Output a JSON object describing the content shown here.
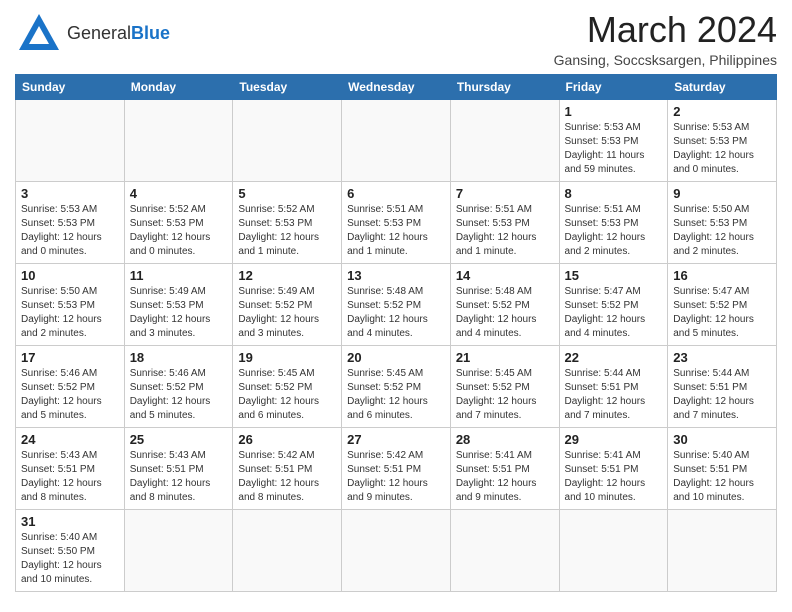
{
  "header": {
    "logo_general": "General",
    "logo_blue": "Blue",
    "title": "March 2024",
    "subtitle": "Gansing, Soccsksargen, Philippines"
  },
  "weekdays": [
    "Sunday",
    "Monday",
    "Tuesday",
    "Wednesday",
    "Thursday",
    "Friday",
    "Saturday"
  ],
  "weeks": [
    [
      {
        "day": "",
        "info": ""
      },
      {
        "day": "",
        "info": ""
      },
      {
        "day": "",
        "info": ""
      },
      {
        "day": "",
        "info": ""
      },
      {
        "day": "",
        "info": ""
      },
      {
        "day": "1",
        "info": "Sunrise: 5:53 AM\nSunset: 5:53 PM\nDaylight: 11 hours and 59 minutes."
      },
      {
        "day": "2",
        "info": "Sunrise: 5:53 AM\nSunset: 5:53 PM\nDaylight: 12 hours and 0 minutes."
      }
    ],
    [
      {
        "day": "3",
        "info": "Sunrise: 5:53 AM\nSunset: 5:53 PM\nDaylight: 12 hours and 0 minutes."
      },
      {
        "day": "4",
        "info": "Sunrise: 5:52 AM\nSunset: 5:53 PM\nDaylight: 12 hours and 0 minutes."
      },
      {
        "day": "5",
        "info": "Sunrise: 5:52 AM\nSunset: 5:53 PM\nDaylight: 12 hours and 1 minute."
      },
      {
        "day": "6",
        "info": "Sunrise: 5:51 AM\nSunset: 5:53 PM\nDaylight: 12 hours and 1 minute."
      },
      {
        "day": "7",
        "info": "Sunrise: 5:51 AM\nSunset: 5:53 PM\nDaylight: 12 hours and 1 minute."
      },
      {
        "day": "8",
        "info": "Sunrise: 5:51 AM\nSunset: 5:53 PM\nDaylight: 12 hours and 2 minutes."
      },
      {
        "day": "9",
        "info": "Sunrise: 5:50 AM\nSunset: 5:53 PM\nDaylight: 12 hours and 2 minutes."
      }
    ],
    [
      {
        "day": "10",
        "info": "Sunrise: 5:50 AM\nSunset: 5:53 PM\nDaylight: 12 hours and 2 minutes."
      },
      {
        "day": "11",
        "info": "Sunrise: 5:49 AM\nSunset: 5:53 PM\nDaylight: 12 hours and 3 minutes."
      },
      {
        "day": "12",
        "info": "Sunrise: 5:49 AM\nSunset: 5:52 PM\nDaylight: 12 hours and 3 minutes."
      },
      {
        "day": "13",
        "info": "Sunrise: 5:48 AM\nSunset: 5:52 PM\nDaylight: 12 hours and 4 minutes."
      },
      {
        "day": "14",
        "info": "Sunrise: 5:48 AM\nSunset: 5:52 PM\nDaylight: 12 hours and 4 minutes."
      },
      {
        "day": "15",
        "info": "Sunrise: 5:47 AM\nSunset: 5:52 PM\nDaylight: 12 hours and 4 minutes."
      },
      {
        "day": "16",
        "info": "Sunrise: 5:47 AM\nSunset: 5:52 PM\nDaylight: 12 hours and 5 minutes."
      }
    ],
    [
      {
        "day": "17",
        "info": "Sunrise: 5:46 AM\nSunset: 5:52 PM\nDaylight: 12 hours and 5 minutes."
      },
      {
        "day": "18",
        "info": "Sunrise: 5:46 AM\nSunset: 5:52 PM\nDaylight: 12 hours and 5 minutes."
      },
      {
        "day": "19",
        "info": "Sunrise: 5:45 AM\nSunset: 5:52 PM\nDaylight: 12 hours and 6 minutes."
      },
      {
        "day": "20",
        "info": "Sunrise: 5:45 AM\nSunset: 5:52 PM\nDaylight: 12 hours and 6 minutes."
      },
      {
        "day": "21",
        "info": "Sunrise: 5:45 AM\nSunset: 5:52 PM\nDaylight: 12 hours and 7 minutes."
      },
      {
        "day": "22",
        "info": "Sunrise: 5:44 AM\nSunset: 5:51 PM\nDaylight: 12 hours and 7 minutes."
      },
      {
        "day": "23",
        "info": "Sunrise: 5:44 AM\nSunset: 5:51 PM\nDaylight: 12 hours and 7 minutes."
      }
    ],
    [
      {
        "day": "24",
        "info": "Sunrise: 5:43 AM\nSunset: 5:51 PM\nDaylight: 12 hours and 8 minutes."
      },
      {
        "day": "25",
        "info": "Sunrise: 5:43 AM\nSunset: 5:51 PM\nDaylight: 12 hours and 8 minutes."
      },
      {
        "day": "26",
        "info": "Sunrise: 5:42 AM\nSunset: 5:51 PM\nDaylight: 12 hours and 8 minutes."
      },
      {
        "day": "27",
        "info": "Sunrise: 5:42 AM\nSunset: 5:51 PM\nDaylight: 12 hours and 9 minutes."
      },
      {
        "day": "28",
        "info": "Sunrise: 5:41 AM\nSunset: 5:51 PM\nDaylight: 12 hours and 9 minutes."
      },
      {
        "day": "29",
        "info": "Sunrise: 5:41 AM\nSunset: 5:51 PM\nDaylight: 12 hours and 10 minutes."
      },
      {
        "day": "30",
        "info": "Sunrise: 5:40 AM\nSunset: 5:51 PM\nDaylight: 12 hours and 10 minutes."
      }
    ],
    [
      {
        "day": "31",
        "info": "Sunrise: 5:40 AM\nSunset: 5:50 PM\nDaylight: 12 hours and 10 minutes."
      },
      {
        "day": "",
        "info": ""
      },
      {
        "day": "",
        "info": ""
      },
      {
        "day": "",
        "info": ""
      },
      {
        "day": "",
        "info": ""
      },
      {
        "day": "",
        "info": ""
      },
      {
        "day": "",
        "info": ""
      }
    ]
  ]
}
